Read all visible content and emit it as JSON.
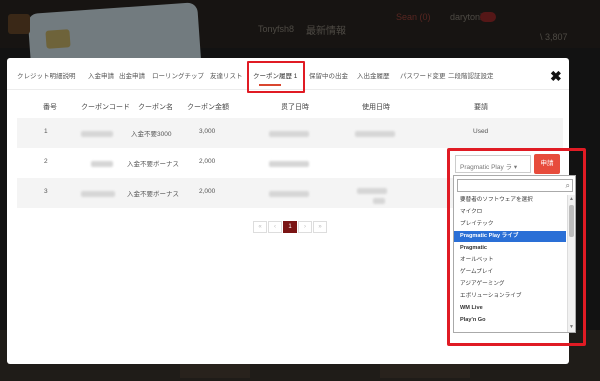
{
  "colors": {
    "accent": "#d9462f",
    "highlight_frame": "#e01b24",
    "selected_option": "#2a6fd6",
    "pager_current": "#7a1414"
  },
  "background_page": {
    "col_news": "最新情報",
    "col_small": "Tonyfsh8",
    "col_red": "Sean (0)",
    "col_user": "darytoni",
    "col_bal": "\\ 3,807"
  },
  "tabs": [
    {
      "label": "クレジット明細説明"
    },
    {
      "label": "入金申請"
    },
    {
      "label": "出金申請"
    },
    {
      "label": "ローリングチップ"
    },
    {
      "label": "友達リスト"
    },
    {
      "label": "クーポン履歴 1",
      "active": true
    },
    {
      "label": "保留中の出金"
    },
    {
      "label": "入出金履歴"
    },
    {
      "label": "パスワード変更"
    },
    {
      "label": "二段階認証設定"
    }
  ],
  "table": {
    "headers": [
      "番号",
      "クーポンコード",
      "クーポン名",
      "クーポン金額",
      "贯了日時",
      "使用日時",
      "要請"
    ],
    "rows": [
      {
        "no": "1",
        "name": "入金不要3000",
        "amount": "3,000",
        "status": "Used"
      },
      {
        "no": "2",
        "name": "入金不要ボーナス",
        "amount": "2,000",
        "status": ""
      },
      {
        "no": "3",
        "name": "入金不要ボーナス",
        "amount": "2,000",
        "status": ""
      }
    ]
  },
  "pagination": {
    "current": "1"
  },
  "provider_select": {
    "selected": "Pragmatic Play ラ ▾",
    "apply_label": "申請",
    "options": [
      {
        "label": "要替者のソフトウェアを選択"
      },
      {
        "label": "マイクロ"
      },
      {
        "label": "プレイテック"
      },
      {
        "label": "Pragmatic Play ライブ",
        "selected": true
      },
      {
        "label": "Pragmatic",
        "bold": true
      },
      {
        "label": "オールベット"
      },
      {
        "label": "ゲームプレイ"
      },
      {
        "label": "アジアゲーミング"
      },
      {
        "label": "エボリューションライブ"
      },
      {
        "label": "WM Live",
        "bold": true
      },
      {
        "label": "Play'n Go",
        "bold": true
      }
    ]
  }
}
